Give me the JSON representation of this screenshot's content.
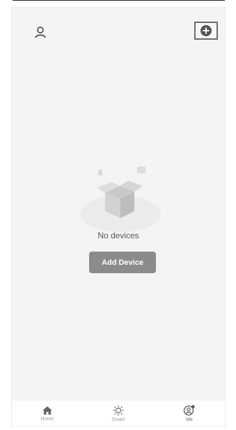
{
  "header": {
    "user_icon": "user-icon",
    "add_icon": "plus-circle-icon"
  },
  "empty_state": {
    "message": "No devices",
    "add_button_label": "Add Device"
  },
  "tabbar": {
    "items": [
      {
        "label": "Home",
        "icon": "home-icon"
      },
      {
        "label": "Smart",
        "icon": "sun-icon"
      },
      {
        "label": "Me",
        "icon": "profile-icon"
      }
    ]
  },
  "colors": {
    "button_gray": "#8b8b8b",
    "background": "#f4f4f4"
  }
}
